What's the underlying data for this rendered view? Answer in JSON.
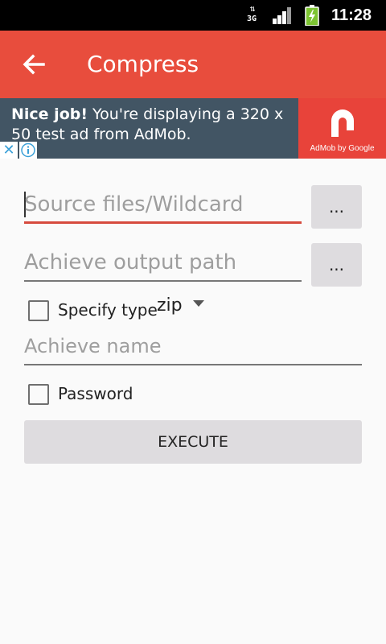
{
  "status_bar": {
    "network_type": "3G",
    "time": "11:28",
    "icons": [
      "data-arrows-icon",
      "signal-icon",
      "battery-charging-icon"
    ]
  },
  "app_bar": {
    "title": "Compress",
    "back_icon": "arrow-left-icon",
    "background": "#e84d3d"
  },
  "ad": {
    "headline": "Nice job!",
    "body": " You're displaying a 320 x 50 test ad from AdMob.",
    "byline": "AdMob by Google",
    "close_glyph": "✕",
    "background": "#425564",
    "logo_background": "#e8433a"
  },
  "form": {
    "source_placeholder": "Source files/Wildcard",
    "output_placeholder": "Achieve output path",
    "browse_label": "...",
    "specify_type_label": "Specify type",
    "type_value": "zip",
    "name_placeholder": "Achieve name",
    "password_label": "Password",
    "execute_label": "EXECUTE",
    "accent": "#d64a3d"
  }
}
